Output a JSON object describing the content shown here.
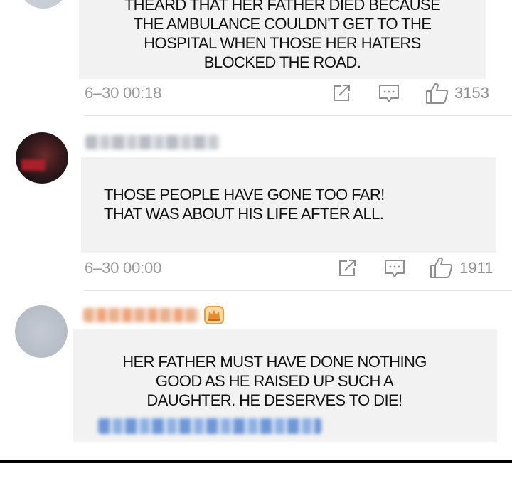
{
  "comments": [
    {
      "text": "THEARD THAT HER FATHER DIED BECAUSE\nTHE AMBULANCE COULDN'T GET TO THE\nHOSPITAL WHEN THOSE HER HATERS\nBLOCKED THE ROAD.",
      "timestamp": "6–30 00:18",
      "likes": "3153"
    },
    {
      "text": "THOSE PEOPLE HAVE GONE TOO FAR!\nTHAT WAS ABOUT HIS LIFE AFTER ALL.",
      "timestamp": "6–30 00:00",
      "likes": "1911"
    },
    {
      "text": "HER FATHER MUST HAVE DONE NOTHING\nGOOD AS HE RAISED UP SUCH A\nDAUGHTER. HE DESERVES TO DIE!"
    }
  ],
  "icons": {
    "share": "share-icon",
    "comment": "comment-icon",
    "like": "thumbs-up-icon",
    "badge": "crown-badge-icon"
  },
  "colors": {
    "bubble": "#f2f2f2",
    "text": "#111111",
    "meta": "#9a9a9a",
    "icon": "#8e8e8e",
    "badge": "#f0a23c"
  }
}
